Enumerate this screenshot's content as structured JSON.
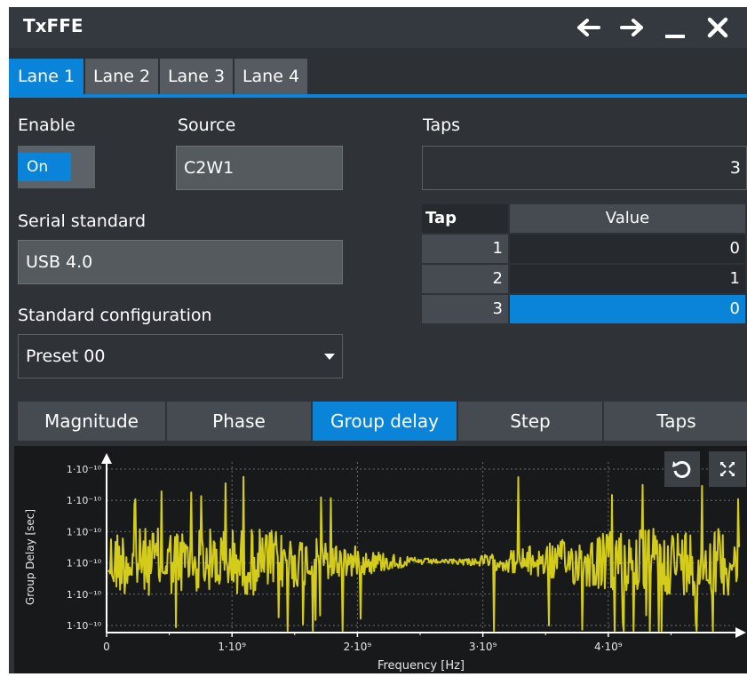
{
  "window": {
    "title": "TxFFE"
  },
  "lanes": [
    "Lane 1",
    "Lane 2",
    "Lane 3",
    "Lane 4"
  ],
  "enable": {
    "label": "Enable",
    "state": "On"
  },
  "source": {
    "label": "Source",
    "value": "C2W1"
  },
  "taps": {
    "label": "Taps",
    "value": "3"
  },
  "serial_standard": {
    "label": "Serial standard",
    "value": "USB 4.0"
  },
  "standard_config": {
    "label": "Standard configuration",
    "value": "Preset 00"
  },
  "tap_table": {
    "headers": [
      "Tap",
      "Value"
    ],
    "rows": [
      {
        "tap": "1",
        "value": "0"
      },
      {
        "tap": "2",
        "value": "1"
      },
      {
        "tap": "3",
        "value": "0"
      }
    ]
  },
  "plot_tabs": [
    "Magnitude",
    "Phase",
    "Group delay",
    "Step",
    "Taps"
  ],
  "active_plot_tab": "Group delay",
  "chart_data": {
    "type": "line",
    "xlabel": "Frequency [Hz]",
    "ylabel": "Group Delay [sec]",
    "x_ticks": [
      "0",
      "1·10⁹",
      "2·10⁹",
      "3·10⁹",
      "4·10⁹"
    ],
    "x_tick_values": [
      0,
      1000000000,
      2000000000,
      3000000000,
      4000000000
    ],
    "y_ticks": [
      "1·10⁻¹⁰",
      "1·10⁻¹⁰",
      "1·10⁻¹⁰",
      "1·10⁻¹⁰",
      "1·10⁻¹⁰",
      "1·10⁻¹⁰"
    ],
    "xlim": [
      0,
      5000000000
    ],
    "series": [
      {
        "color": "#d4cc1a"
      }
    ],
    "grid": true
  },
  "colors": {
    "accent": "#0a84d8",
    "trace": "#d4cc1a",
    "panel": "#2f3338"
  }
}
